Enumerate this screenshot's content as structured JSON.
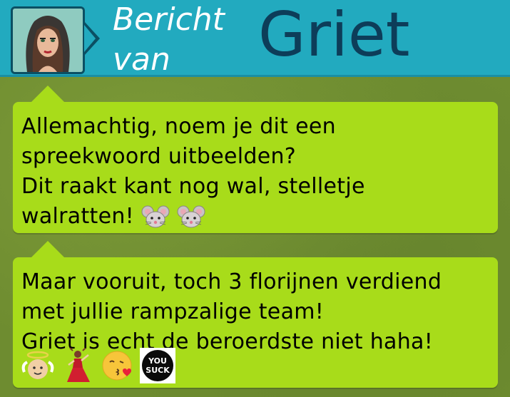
{
  "header": {
    "line1": "Bericht",
    "line2": "van",
    "name": "Griet",
    "avatar_icon": "woman-portrait-avatar"
  },
  "messages": [
    {
      "lines": [
        "Allemachtig, noem je dit een",
        "spreekwoord uitbeelden?",
        "Dit raakt kant nog wal, stelletje",
        "walratten!"
      ],
      "emojis": [
        "mouse-face-icon",
        "mouse-face-icon"
      ]
    },
    {
      "lines": [
        "Maar vooruit, toch 3 florijnen verdiend",
        "met jullie rampzalige team!",
        "Griet is echt de beroerdste niet haha!"
      ],
      "emojis": [
        "angel-face-icon",
        "flamenco-dancer-icon",
        "kissing-face-icon",
        "you-suck-badge"
      ],
      "badge_text": [
        "YOU",
        "SUCK"
      ]
    }
  ],
  "colors": {
    "header_bg": "#22aabf",
    "name": "#0d3d59",
    "bubble": "#a8dc1a",
    "background": "#6e8c30"
  }
}
